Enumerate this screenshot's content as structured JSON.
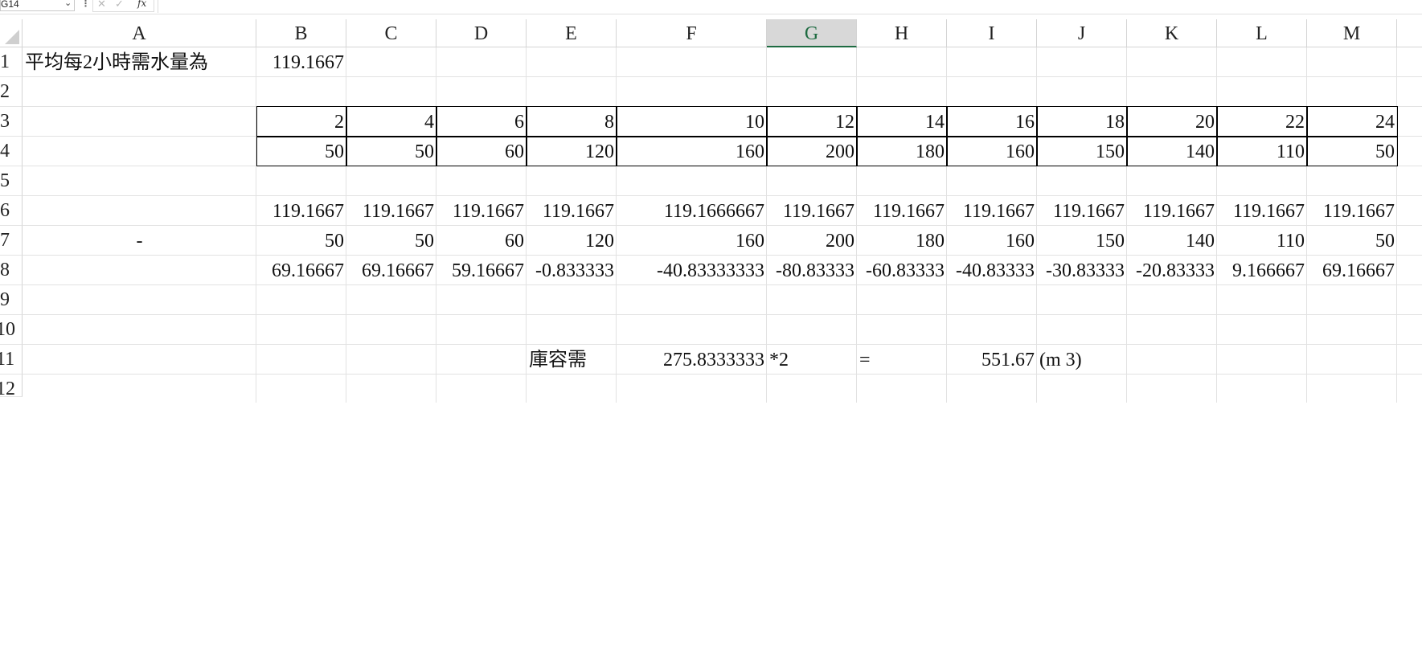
{
  "formula_bar": {
    "name_box": "G14",
    "dropdown_glyph": "⌄",
    "separator_glyph": "⋮",
    "cancel_glyph": "✕",
    "enter_glyph": "✓",
    "fx_label": "fx",
    "formula": ""
  },
  "columns": [
    "A",
    "B",
    "C",
    "D",
    "E",
    "F",
    "G",
    "H",
    "I",
    "J",
    "K",
    "L",
    "M"
  ],
  "selected_column": "G",
  "rows": [
    "1",
    "2",
    "3",
    "4",
    "5",
    "6",
    "7",
    "8",
    "9",
    "10",
    "11",
    "12"
  ],
  "cells": {
    "A1": "平均每2小時需水量為",
    "B1": "119.1667",
    "B3": "2",
    "C3": "4",
    "D3": "6",
    "E3": "8",
    "F3": "10",
    "G3": "12",
    "H3": "14",
    "I3": "16",
    "J3": "18",
    "K3": "20",
    "L3": "22",
    "M3": "24",
    "B4": "50",
    "C4": "50",
    "D4": "60",
    "E4": "120",
    "F4": "160",
    "G4": "200",
    "H4": "180",
    "I4": "160",
    "J4": "150",
    "K4": "140",
    "L4": "110",
    "M4": "50",
    "B6": "119.1667",
    "C6": "119.1667",
    "D6": "119.1667",
    "E6": "119.1667",
    "F6": "119.1666667",
    "G6": "119.1667",
    "H6": "119.1667",
    "I6": "119.1667",
    "J6": "119.1667",
    "K6": "119.1667",
    "L6": "119.1667",
    "M6": "119.1667",
    "A7": "-",
    "B7": "50",
    "C7": "50",
    "D7": "60",
    "E7": "120",
    "F7": "160",
    "G7": "200",
    "H7": "180",
    "I7": "160",
    "J7": "150",
    "K7": "140",
    "L7": "110",
    "M7": "50",
    "B8": "69.16667",
    "C8": "69.16667",
    "D8": "59.16667",
    "E8": "-0.833333",
    "F8": "-40.83333333",
    "G8": "-80.83333",
    "H8": "-60.83333",
    "I8": "-40.83333",
    "J8": "-30.83333",
    "K8": "-20.83333",
    "L8": "9.166667",
    "M8": "69.16667",
    "E11": "庫容需",
    "F11": "275.8333333",
    "G11": "*2",
    "H11": "=",
    "I11": "551.67",
    "J11": "(m 3)"
  }
}
